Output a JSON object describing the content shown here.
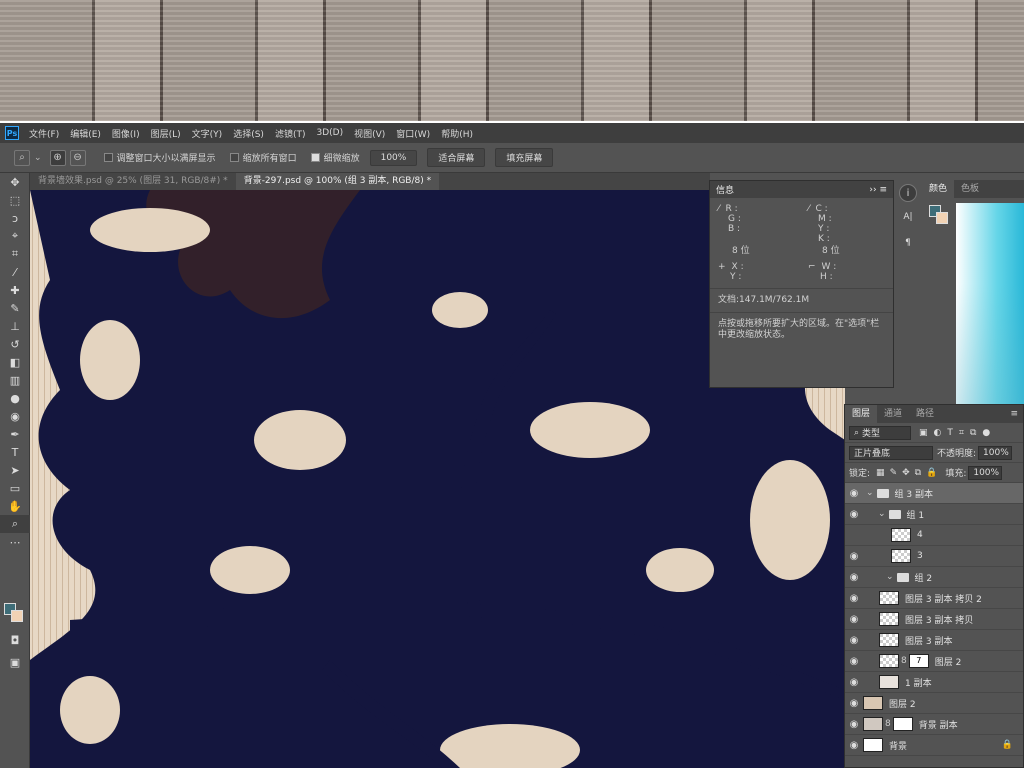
{
  "colors": {
    "accent": "#31a8ff",
    "foreground": "#3e6d78",
    "background": "#f1d2b4",
    "tree": "#14163e"
  },
  "app": {
    "logo": "Ps"
  },
  "menu": [
    "文件(F)",
    "编辑(E)",
    "图像(I)",
    "图层(L)",
    "文字(Y)",
    "选择(S)",
    "滤镜(T)",
    "3D(D)",
    "视图(V)",
    "窗口(W)",
    "帮助(H)"
  ],
  "options": {
    "resize_windows": "调整窗口大小以满屏显示",
    "zoom_all": "缩放所有窗口",
    "scrubby_zoom": "细微缩放",
    "zoom_value": "100%",
    "fit_screen": "适合屏幕",
    "fill_screen": "填充屏幕"
  },
  "tabs": [
    "背景墙效果.psd @ 25% (图层 31, RGB/8#) *",
    "背景-297.psd @ 100% (组 3 副本, RGB/8) *"
  ],
  "info": {
    "title": "信息",
    "r": "R :",
    "g": "G :",
    "b": "B :",
    "c": "C :",
    "m": "M :",
    "y": "Y :",
    "k": "K :",
    "bit1": "8 位",
    "bit2": "8 位",
    "x": "X :",
    "yc": "Y :",
    "w": "W :",
    "h": "H :",
    "doc": "文档:147.1M/762.1M",
    "hint": "点按或拖移所要扩大的区域。在\"选项\"栏中更改缩放状态。"
  },
  "color_panel": {
    "tab1": "颜色",
    "tab2": "色板"
  },
  "layers": {
    "tabs": [
      "图层",
      "通道",
      "路径"
    ],
    "filter": "类型",
    "blend": "正片叠底",
    "opacity_label": "不透明度:",
    "opacity": "100%",
    "lock_label": "锁定:",
    "fill_label": "填充:",
    "fill": "100%",
    "items": [
      "组 3 副本",
      "组 1",
      "4",
      "3",
      "组 2",
      "图层 3 副本 拷贝 2",
      "图层 3 副本 拷贝",
      "图层 3 副本",
      "图层 2",
      "1 副本",
      "图层 2",
      "背景 副本",
      "背景"
    ],
    "mask_digit": "7"
  }
}
